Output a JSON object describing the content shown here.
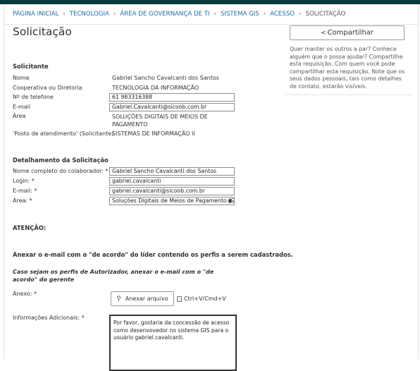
{
  "breadcrumb": {
    "items": [
      "PÁGINA INICIAL",
      "TECNOLOGIA",
      "ÁREA DE GOVERNANÇA DE TI",
      "SISTEMA GIS",
      "ACESSO"
    ],
    "current": "SOLICITAÇÃO",
    "separator": "›"
  },
  "page_title": "Solicitação",
  "share": {
    "button_label": "Compartilhar",
    "icon": "share-icon",
    "description": "Quer manter os outros a par? Conhece alguém que o possa ajudar? Compartilhe esta requisição. Com quem você pode compartilhar esta requisição. Note que os seus dados pessoais, tais como detalhes de contato, estarão visíveis."
  },
  "requester": {
    "section_title": "Solicitante",
    "name_label": "Nome",
    "name_value": "Gabriel Sancho Cavalcanti dos Santos",
    "coop_label": "Cooperativa ou Diretoria",
    "coop_value": "TECNOLOGIA DA INFORMAÇÃO",
    "phone_label": "Nº de telefone",
    "phone_value": "61 983316388",
    "email_label": "E-mail",
    "email_value": "Gabriel.Cavalcanti@sicoob.com.br",
    "area_label": "Área",
    "area_value": "SOLUÇÕES DIGITAIS DE MEIOS DE PAGAMENTO",
    "post_label": "'Posto de atendimento' (Solicitante)",
    "post_value": "SISTEMAS DE INFORMAÇÃO II"
  },
  "details": {
    "section_title": "Detalhamento da Solicitação",
    "fullname_label": "Nome completo do colaborador: *",
    "fullname_value": "Gabriel Sancho Cavalcanti dos Santos",
    "login_label": "Login: *",
    "login_value": "gabriel.cavalcanti",
    "email_label": "E-mail: *",
    "email_value": "gabriel.cavalcanti@sicoob.com.br",
    "area_label": "Área: *",
    "area_value": "Soluções Digitais de Meios de Pagamento (GESC"
  },
  "notice": {
    "title": "ATENÇÃO:",
    "instruction": "Anexar o e-mail com o \"de acordo\" do líder contendo os perfis a serem cadastrados.",
    "note": "Caso sejam os perfis de Autorizador, anexar o e-mail com o \"de acordo\" do gerente"
  },
  "attachment": {
    "label": "Anexo: *",
    "button_label": "Anexar arquivo",
    "icon": "paperclip-icon",
    "paste_hint": "Ctrl+V/Cmd+V"
  },
  "additional": {
    "label": "Informações Adicionais: *",
    "value": "Por favor, gostaria da concessão de acesso como desenvovedor no sistema GIS para o usuário gabriel.cavalcanti."
  }
}
